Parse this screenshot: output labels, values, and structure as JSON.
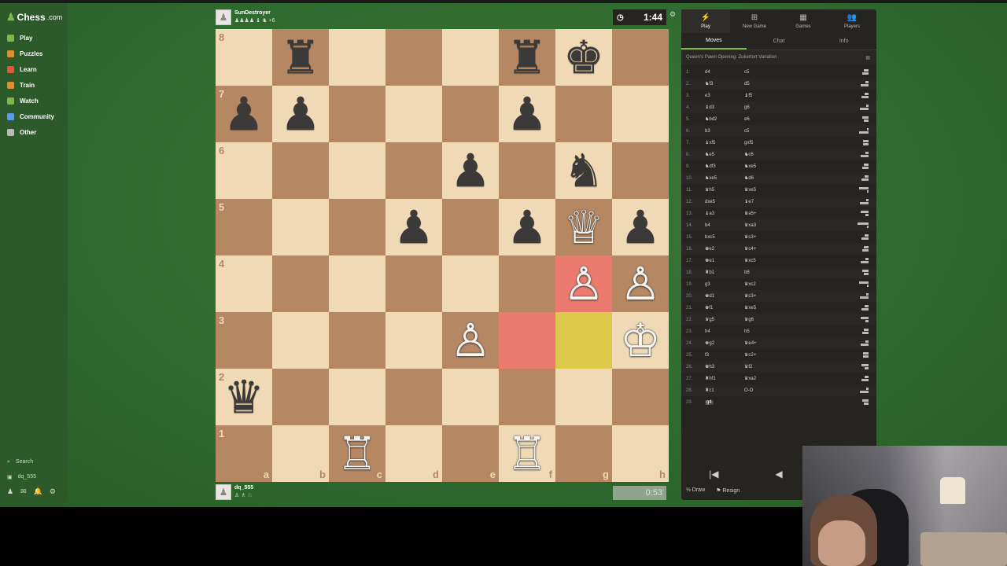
{
  "site": {
    "logo_text": "Chess",
    "logo_domain": ".com"
  },
  "sidebar": {
    "items": [
      {
        "label": "Play",
        "color": "#81b64c"
      },
      {
        "label": "Puzzles",
        "color": "#e58f2a"
      },
      {
        "label": "Learn",
        "color": "#d85b3c"
      },
      {
        "label": "Train",
        "color": "#e58f2a"
      },
      {
        "label": "Watch",
        "color": "#81b64c"
      },
      {
        "label": "Community",
        "color": "#5d9cec"
      },
      {
        "label": "Other",
        "color": "#bdbab6"
      }
    ],
    "search_label": "Search",
    "user_label": "dq_555"
  },
  "top_player": {
    "name": "SunDestroyer",
    "captures": "♟♟♟♟ ♝ ♞ +6"
  },
  "bottom_player": {
    "name": "dq_555",
    "captures": "♙ ♗ ♘"
  },
  "clocks": {
    "top": "1:44",
    "bottom": "0:53"
  },
  "board": {
    "rank_labels": [
      "8",
      "7",
      "6",
      "5",
      "4",
      "3",
      "2",
      "1"
    ],
    "file_labels": [
      "a",
      "b",
      "c",
      "d",
      "e",
      "f",
      "g",
      "h"
    ],
    "highlights": {
      "f3": "red",
      "g4": "red",
      "g3": "yellow"
    },
    "pieces": [
      {
        "square": "b8",
        "glyph": "♜",
        "color": "black"
      },
      {
        "square": "f8",
        "glyph": "♜",
        "color": "black"
      },
      {
        "square": "g8",
        "glyph": "♚",
        "color": "black"
      },
      {
        "square": "a7",
        "glyph": "♟",
        "color": "black"
      },
      {
        "square": "b7",
        "glyph": "♟",
        "color": "black"
      },
      {
        "square": "f7",
        "glyph": "♟",
        "color": "black"
      },
      {
        "square": "e6",
        "glyph": "♟",
        "color": "black"
      },
      {
        "square": "g6",
        "glyph": "♞",
        "color": "black"
      },
      {
        "square": "d5",
        "glyph": "♟",
        "color": "black"
      },
      {
        "square": "f5",
        "glyph": "♟",
        "color": "black"
      },
      {
        "square": "g5",
        "glyph": "♕",
        "color": "white"
      },
      {
        "square": "h5",
        "glyph": "♟",
        "color": "black"
      },
      {
        "square": "g4",
        "glyph": "♙",
        "color": "white"
      },
      {
        "square": "h4",
        "glyph": "♙",
        "color": "white"
      },
      {
        "square": "e3",
        "glyph": "♙",
        "color": "white"
      },
      {
        "square": "h3",
        "glyph": "♔",
        "color": "white"
      },
      {
        "square": "a2",
        "glyph": "♛",
        "color": "black"
      },
      {
        "square": "c1",
        "glyph": "♖",
        "color": "white"
      },
      {
        "square": "f1",
        "glyph": "♖",
        "color": "white"
      }
    ]
  },
  "panel": {
    "tabs": [
      {
        "label": "Play",
        "icon": "⚡"
      },
      {
        "label": "New Game",
        "icon": "⊞"
      },
      {
        "label": "Games",
        "icon": "▦"
      },
      {
        "label": "Players",
        "icon": "👥"
      }
    ],
    "subtabs": [
      "Moves",
      "Chat",
      "Info"
    ],
    "opening": "Queen's Pawn Opening: Zukertort Variation",
    "moves": [
      {
        "n": "1.",
        "w": "d4",
        "b": "c5"
      },
      {
        "n": "2.",
        "w": "♞f3",
        "b": "d5"
      },
      {
        "n": "3.",
        "w": "e3",
        "b": "♝f5"
      },
      {
        "n": "4.",
        "w": "♝d3",
        "b": "g6"
      },
      {
        "n": "5.",
        "w": "♞bd2",
        "b": "e6"
      },
      {
        "n": "6.",
        "w": "b3",
        "b": "c5"
      },
      {
        "n": "7.",
        "w": "♝xf5",
        "b": "gxf5"
      },
      {
        "n": "8.",
        "w": "♞e5",
        "b": "♞c6"
      },
      {
        "n": "9.",
        "w": "♞df3",
        "b": "♞xe5"
      },
      {
        "n": "10.",
        "w": "♞xe5",
        "b": "♞d6"
      },
      {
        "n": "11.",
        "w": "♛h5",
        "b": "♛xe5"
      },
      {
        "n": "12.",
        "w": "dxe5",
        "b": "♝e7"
      },
      {
        "n": "13.",
        "w": "♝a3",
        "b": "♛a5+"
      },
      {
        "n": "14.",
        "w": "b4",
        "b": "♛xa3"
      },
      {
        "n": "15.",
        "w": "bxc5",
        "b": "♛c3+"
      },
      {
        "n": "16.",
        "w": "♚e2",
        "b": "♛c4+"
      },
      {
        "n": "17.",
        "w": "♚e1",
        "b": "♛xc5"
      },
      {
        "n": "18.",
        "w": "♜b1",
        "b": "b8"
      },
      {
        "n": "19.",
        "w": "g3",
        "b": "♛xc2"
      },
      {
        "n": "20.",
        "w": "♚d1",
        "b": "♛c3+"
      },
      {
        "n": "21.",
        "w": "♚f1",
        "b": "♛xe5"
      },
      {
        "n": "22.",
        "w": "♛g5",
        "b": "♛g6"
      },
      {
        "n": "23.",
        "w": "h4",
        "b": "h5"
      },
      {
        "n": "24.",
        "w": "♚g2",
        "b": "♛e4+"
      },
      {
        "n": "25.",
        "w": "f3",
        "b": "♛c2+"
      },
      {
        "n": "26.",
        "w": "♚h3",
        "b": "♛f2"
      },
      {
        "n": "27.",
        "w": "♜hf1",
        "b": "♛xa2"
      },
      {
        "n": "28.",
        "w": "♜c1",
        "b": "O-O"
      },
      {
        "n": "29.",
        "w": "g4",
        "b": ""
      }
    ],
    "controls": {
      "first": "|◀",
      "prev": "◀",
      "next": "▶"
    },
    "actions": {
      "draw": "Draw",
      "draw_icon": "½",
      "resign": "Resign",
      "resign_icon": "⚑"
    }
  }
}
